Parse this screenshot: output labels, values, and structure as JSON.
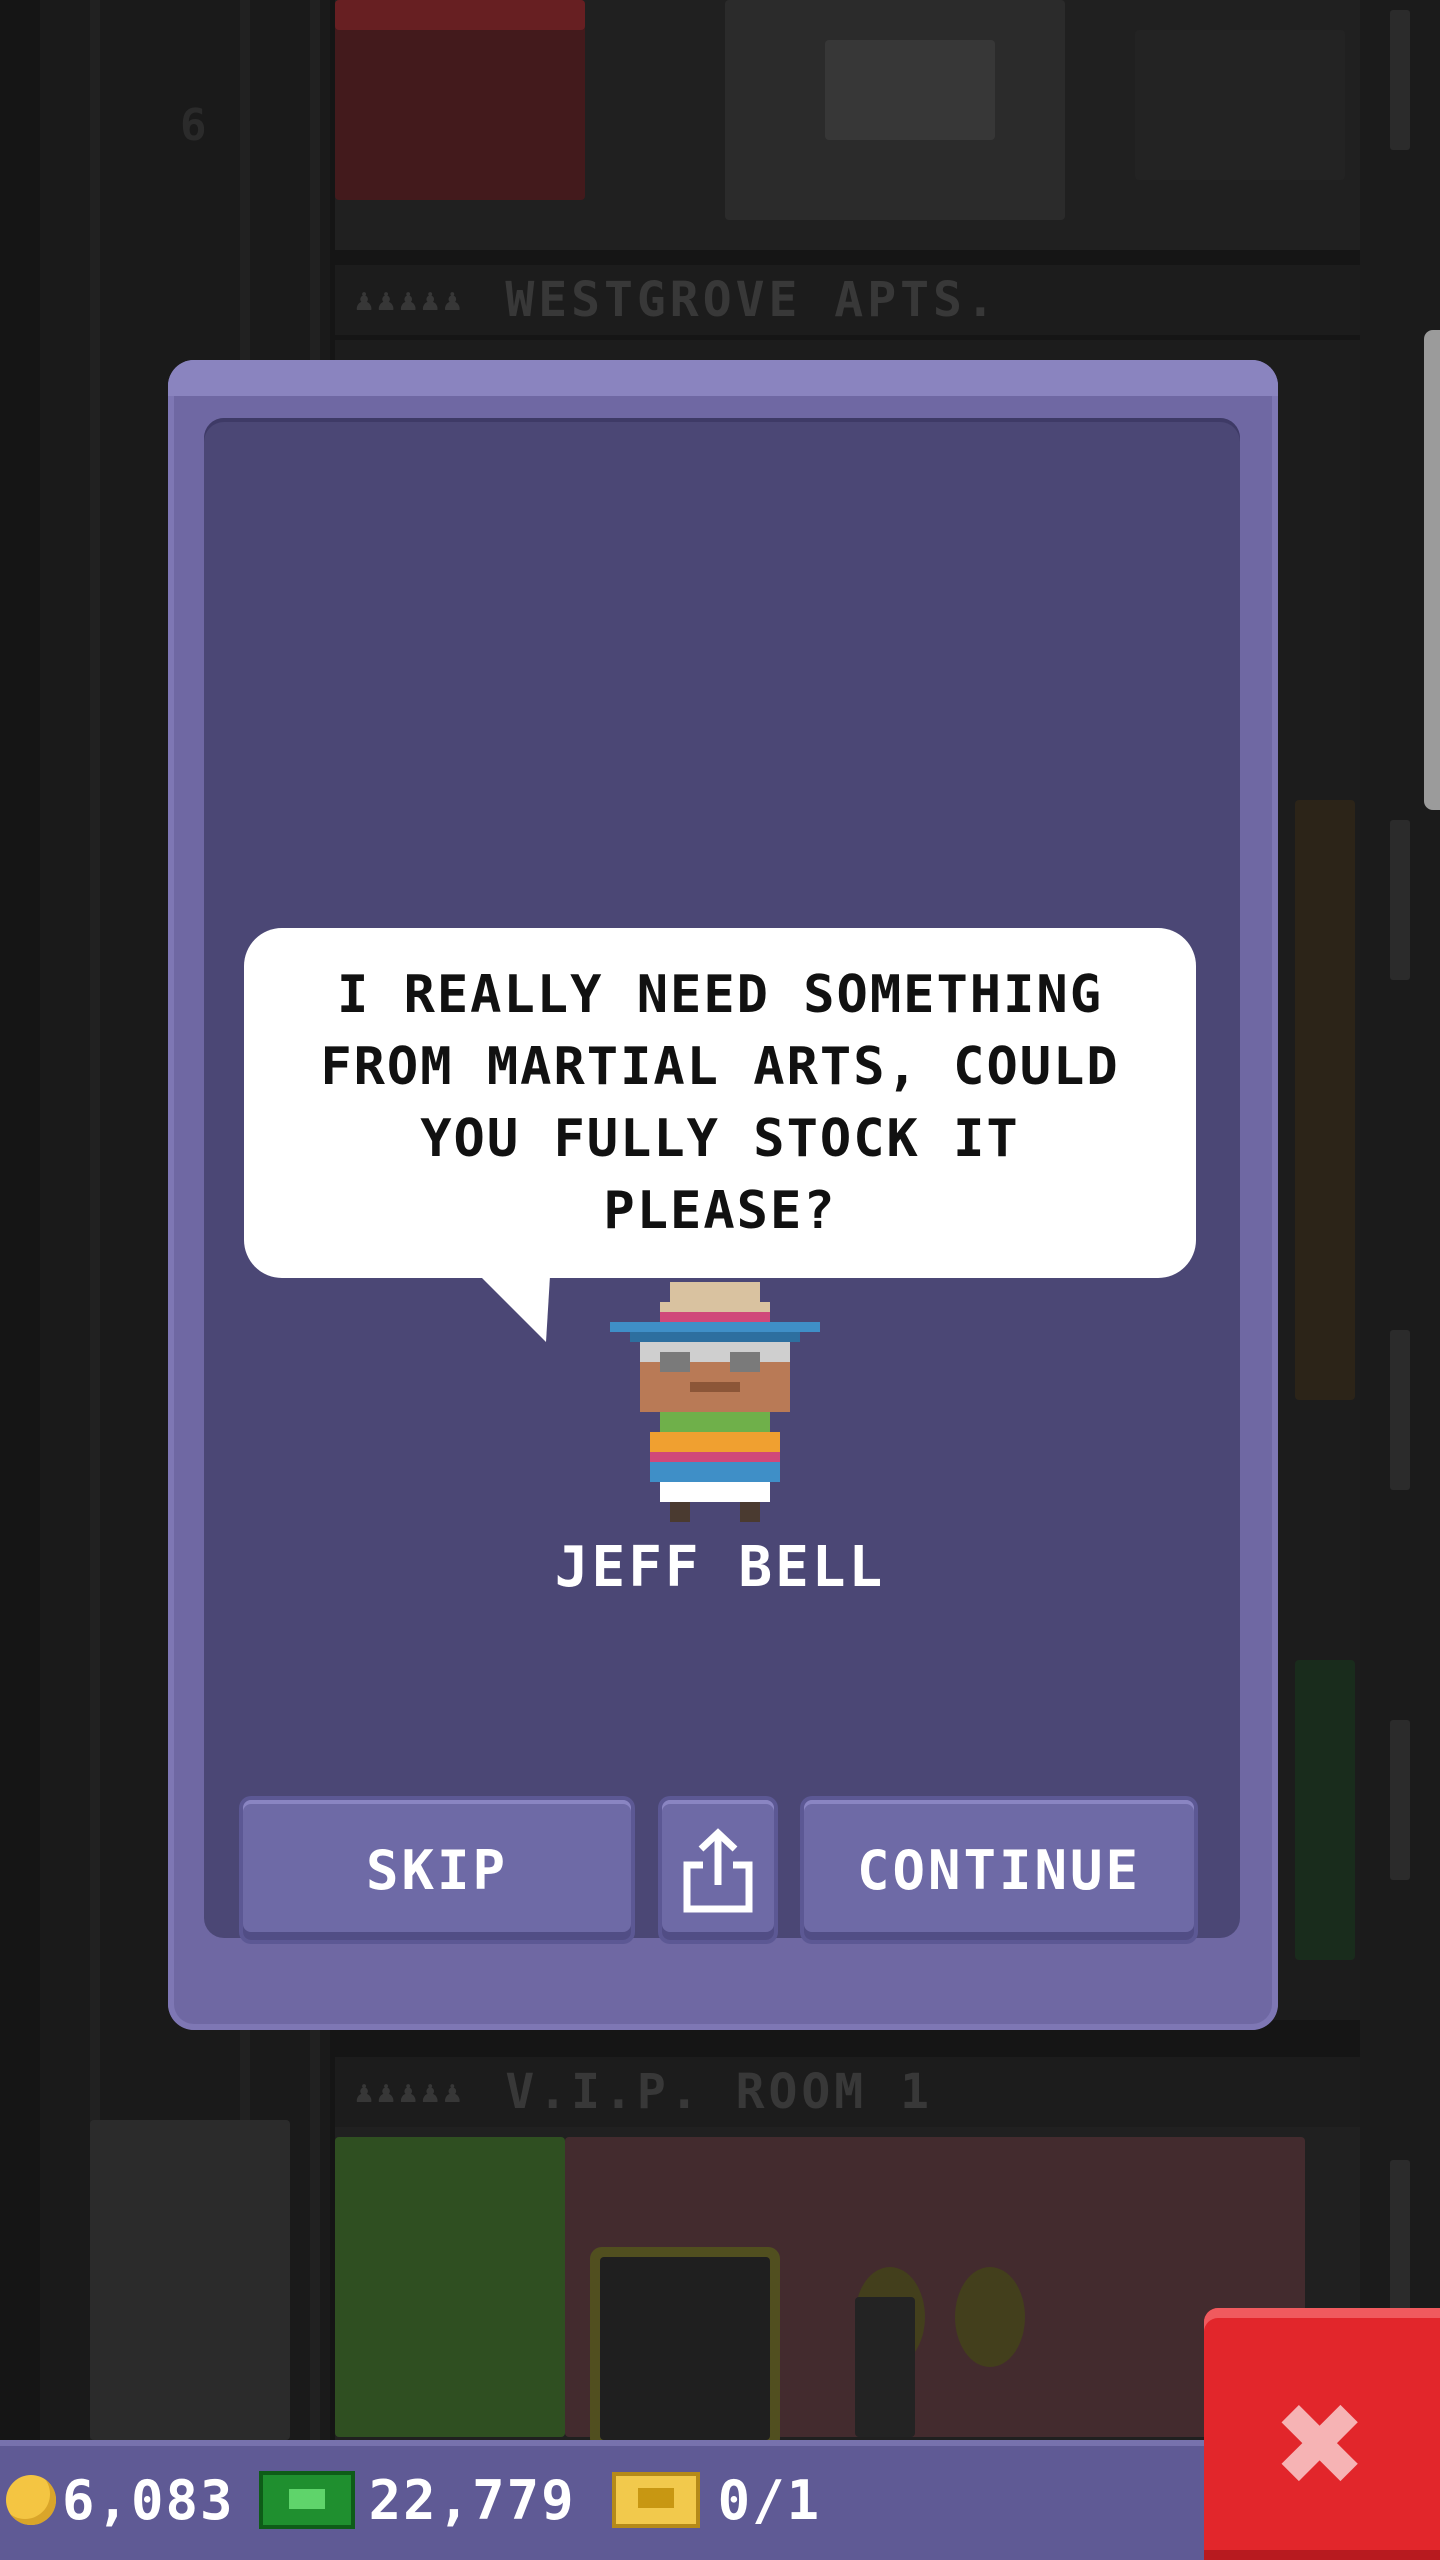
{
  "background": {
    "floor_number": "6",
    "floors": [
      {
        "name": "WESTGROVE APTS."
      },
      {
        "name": "V.I.P. ROOM 1"
      }
    ]
  },
  "dialog": {
    "speech": "I REALLY NEED SOMETHING\nFROM MARTIAL ARTS, COULD\nYOU FULLY STOCK IT\nPLEASE?",
    "character_name": "JEFF BELL",
    "buttons": {
      "skip": "SKIP",
      "share_icon": "share-icon",
      "continue": "CONTINUE"
    }
  },
  "hud": {
    "coins": "6,083",
    "bux": "22,779",
    "tickets": "0/1"
  },
  "colors": {
    "modal_frame": "#6f68a3",
    "modal_inner": "#4b4775",
    "close_button": "#e2262b",
    "hud_bar": "#5f5a95"
  }
}
